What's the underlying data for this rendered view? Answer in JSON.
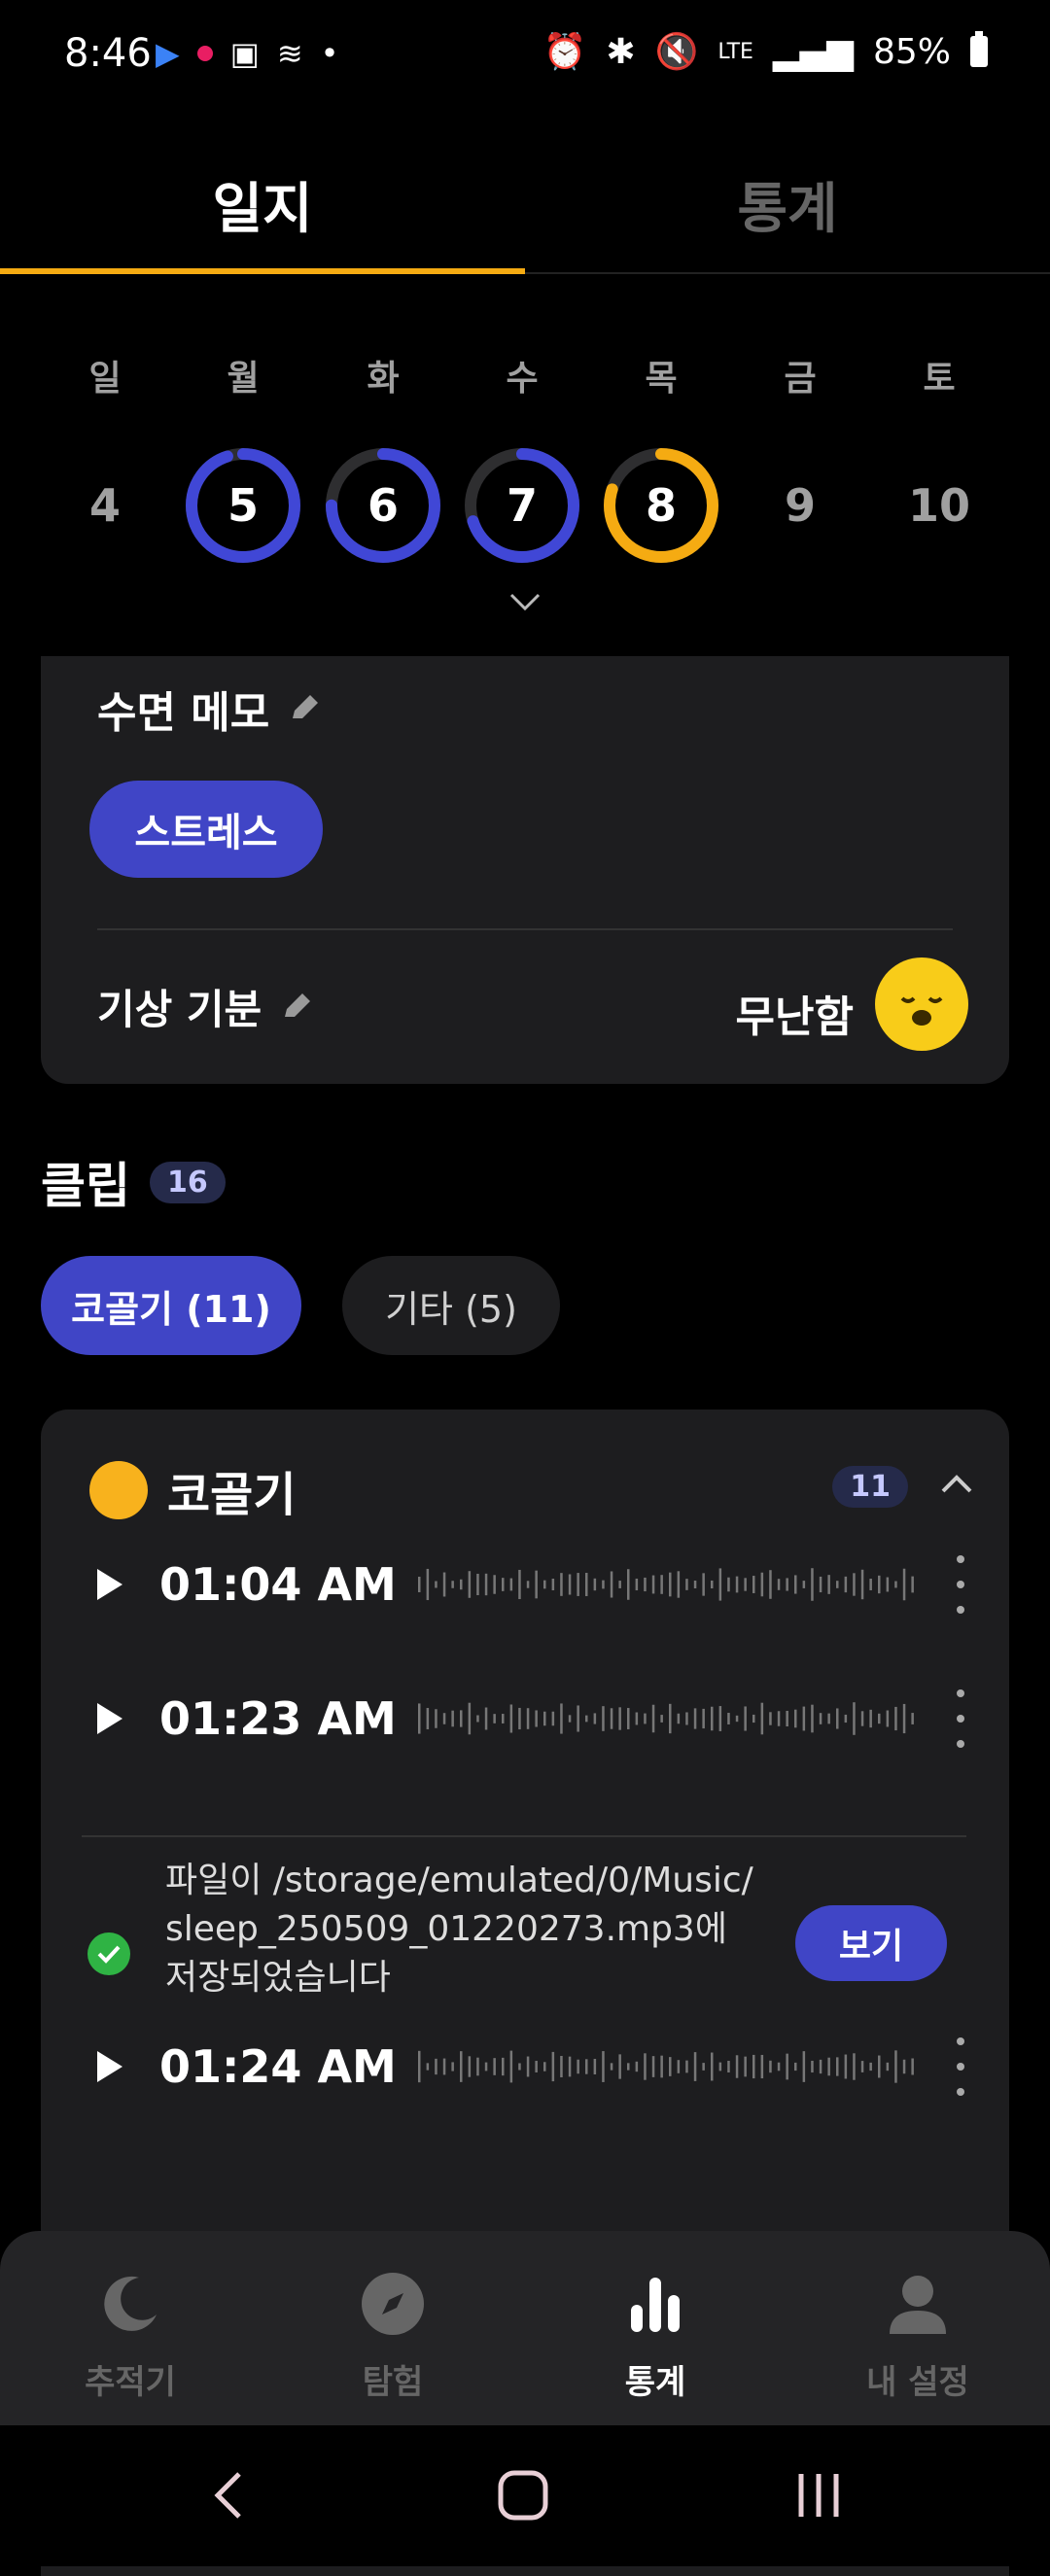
{
  "status_bar": {
    "time": "8:46",
    "battery": "85%"
  },
  "tabs": {
    "journal": "일지",
    "stats": "통계"
  },
  "week": {
    "weekdays": [
      "일",
      "월",
      "화",
      "수",
      "목",
      "금",
      "토"
    ],
    "days": [
      "4",
      "5",
      "6",
      "7",
      "8",
      "9",
      "10"
    ],
    "progress": [
      null,
      0.95,
      0.75,
      0.7,
      0.8,
      null,
      null
    ],
    "ring_colors": [
      "",
      "#4047d6",
      "#4047d6",
      "#4047d6",
      "#f5ab12",
      "",
      ""
    ]
  },
  "memo": {
    "title": "수면 메모",
    "tag": "스트레스",
    "mood_label": "기상 기분",
    "mood_value": "무난함"
  },
  "clips": {
    "title": "클립",
    "count": "16",
    "filters": {
      "snore": "코골기 (11)",
      "other": "기타 (5)"
    },
    "section_title": "코골기",
    "section_count": "11",
    "rows": [
      {
        "time": "01:04 AM"
      },
      {
        "time": "01:23 AM"
      },
      {
        "time": "01:24 AM"
      }
    ],
    "saved_message": "파일이 /storage/emulated/0/Music/ sleep_250509_01220273.mp3에 저장되었습니다",
    "view_button": "보기"
  },
  "bottom_nav": {
    "tracker": "추적기",
    "explore": "탐험",
    "stats": "통계",
    "settings": "내 설정"
  },
  "colors": {
    "accent": "#4045c6",
    "highlight": "#f5ab12"
  }
}
